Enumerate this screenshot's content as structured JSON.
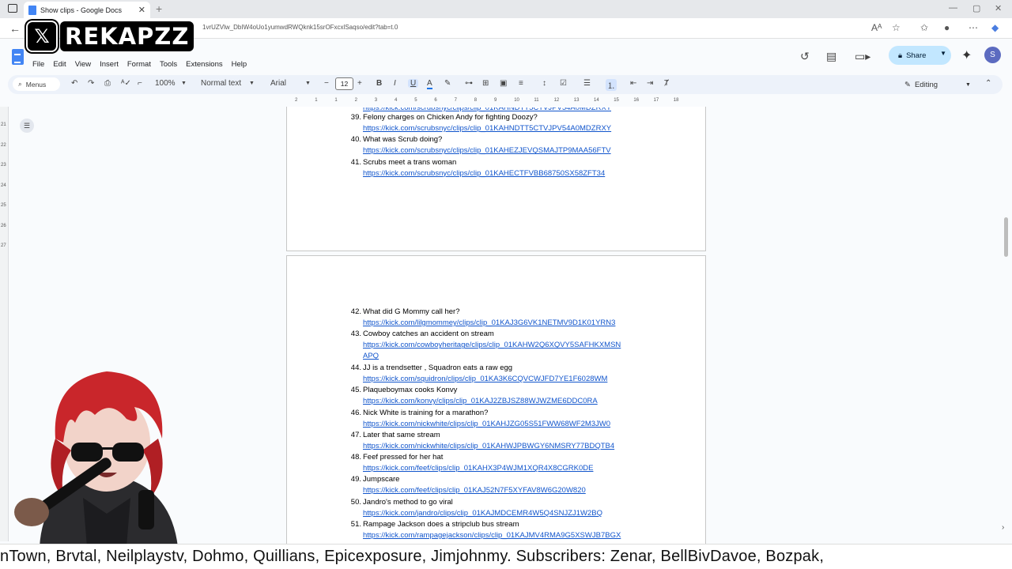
{
  "browser": {
    "tab_title": "Show clips - Google Docs",
    "new_tab_label": "+",
    "url": "1vrUZVlw_DbIW4oUo1yumwdRWQknk15srOFxcxlSaqso/edit?tab=t.0"
  },
  "overlay": {
    "x_logo": "𝕏",
    "brand_name": "REKAPZZ"
  },
  "docs": {
    "doc_title": "Show clips",
    "menu": [
      "File",
      "Edit",
      "View",
      "Insert",
      "Format",
      "Tools",
      "Extensions",
      "Help"
    ],
    "share_label": "Share",
    "avatar_letter": "S"
  },
  "toolbar": {
    "search_label": "Menus",
    "zoom": "100%",
    "style": "Normal text",
    "font": "Arial",
    "font_size": "12",
    "bold": "B",
    "italic": "I",
    "underline": "U",
    "text_color": "A",
    "editing_label": "Editing"
  },
  "ruler": {
    "top_ticks": [
      "2",
      "1",
      "1",
      "2",
      "3",
      "4",
      "5",
      "6",
      "7",
      "8",
      "9",
      "10",
      "11",
      "12",
      "13",
      "14",
      "15",
      "16",
      "17",
      "18"
    ],
    "left_ticks": [
      "21",
      "22",
      "23",
      "24",
      "25",
      "26",
      "27"
    ]
  },
  "page1": {
    "partial_link": "https://kick.com/scrubsnyc/clips/clip_01KAHNDTT5CTVJPV54A0MDZRXY",
    "entries": [
      {
        "num": "39.",
        "title": "Felony charges on Chicken Andy for fighting Doozy?",
        "link": "https://kick.com/scrubsnyc/clips/clip_01KAHNDTT5CTVJPV54A0MDZRXY"
      },
      {
        "num": "40.",
        "title": "What was Scrub doing?",
        "link": "https://kick.com/scrubsnyc/clips/clip_01KAHEZJEVQSMAJTP9MAA56FTV"
      },
      {
        "num": "41.",
        "title": "Scrubs meet a trans woman",
        "link": "https://kick.com/scrubsnyc/clips/clip_01KAHECTFVBB68750SX58ZFT34"
      }
    ]
  },
  "page2": {
    "entries": [
      {
        "num": "42.",
        "title": "What did G Mommy call her?",
        "link": "https://kick.com/lilgmommey/clips/clip_01KAJ3G6VK1NETMV9D1K01YRN3",
        "link2": ""
      },
      {
        "num": "43.",
        "title": "Cowboy catches an accident on stream",
        "link": "https://kick.com/cowboyheritage/clips/clip_01KAHW2Q6XQVY5SAFHKXMSN",
        "link2": "APQ"
      },
      {
        "num": "44.",
        "title": "JJ is a trendsetter , Squadron eats a raw egg",
        "link": "https://kick.com/squidron/clips/clip_01KA3K6CQVCWJFD7YE1F6028WM",
        "link2": ""
      },
      {
        "num": "45.",
        "title": "Plaqueboymax cooks Konvy",
        "link": "https://kick.com/konvy/clips/clip_01KAJ2ZBJSZ88WJWZME6DDC0RA",
        "link2": ""
      },
      {
        "num": "46.",
        "title": "Nick White is training for a marathon?",
        "link": "https://kick.com/nickwhite/clips/clip_01KAHJZG05S51FWW68WF2M3JW0",
        "link2": ""
      },
      {
        "num": "47.",
        "title": "Later that same stream",
        "link": "https://kick.com/nickwhite/clips/clip_01KAHWJPBWGY6NMSRY77BDQTB4",
        "link2": ""
      },
      {
        "num": "48.",
        "title": "Feef pressed for her hat",
        "link": "https://kick.com/feef/clips/clip_01KAHX3P4WJM1XQR4X8CGRK0DE",
        "link2": ""
      },
      {
        "num": "49.",
        "title": "Jumpscare",
        "link": "https://kick.com/feef/clips/clip_01KAJ52N7F5XYFAV8W6G20W820",
        "link2": ""
      },
      {
        "num": "50.",
        "title": "Jandro's method to go viral",
        "link": "https://kick.com/jandro/clips/clip_01KAJMDCEMR4W5Q4SNJZJ1W2BQ",
        "link2": ""
      },
      {
        "num": "51.",
        "title": "Rampage Jackson does a stripclub bus stream",
        "link": "https://kick.com/rampagejackson/clips/clip_01KAJMV4RMA9G5XSWJB7BGX",
        "link2": ""
      }
    ]
  },
  "ticker": {
    "text": "nTown, Brvtal, Neilplaystv, Dohmo, Quillians, Epicexposure, Jimjohnmy.  Subscribers: Zenar, BellBivDavoe, Bozpak,"
  },
  "colors": {
    "link": "#1155cc",
    "share_bg": "#c2e7ff",
    "toolbar_bg": "#edf2fa"
  }
}
